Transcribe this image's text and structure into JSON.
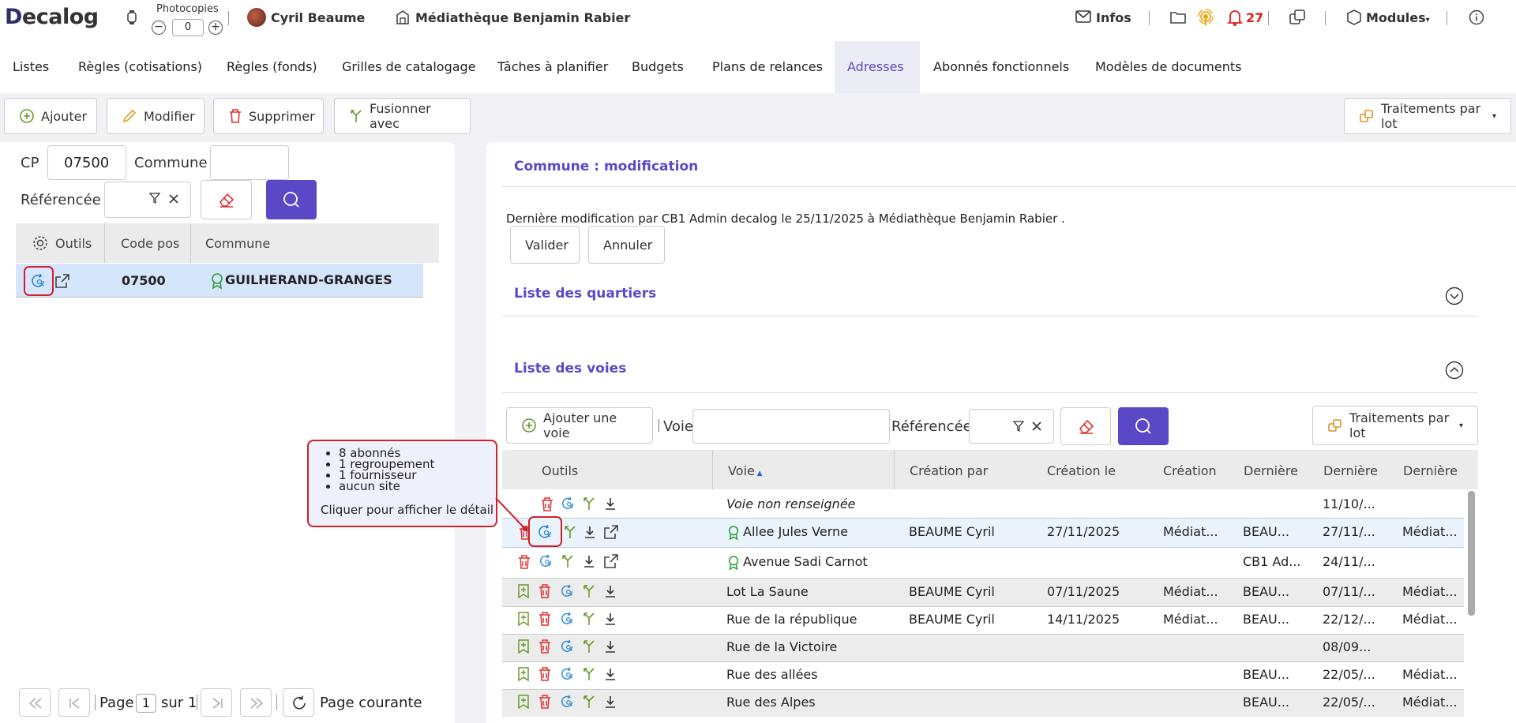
{
  "header": {
    "logo_text": "ecalog",
    "logo_d": "D",
    "photocopies_label": "Photocopies",
    "photocopies_value": "0",
    "user_name": "Cyril Beaume",
    "library_name": "Médiathèque Benjamin Rabier",
    "infos_label": "Infos",
    "notif_count": "27",
    "modules_label": "Modules"
  },
  "tabs": [
    {
      "label": "Listes"
    },
    {
      "label": "Règles (cotisations)"
    },
    {
      "label": "Règles (fonds)"
    },
    {
      "label": "Grilles de catalogage"
    },
    {
      "label": "Tâches à planifier"
    },
    {
      "label": "Budgets"
    },
    {
      "label": "Plans de relances"
    },
    {
      "label": "Adresses"
    },
    {
      "label": "Abonnés fonctionnels"
    },
    {
      "label": "Modèles de documents"
    }
  ],
  "toolbar": {
    "add": "Ajouter",
    "edit": "Modifier",
    "delete": "Supprimer",
    "merge": "Fusionner avec",
    "batch": "Traitements par lot"
  },
  "left": {
    "cp_label": "CP",
    "cp_value": "07500",
    "commune_label": "Commune",
    "commune_value": "",
    "referenced_label": "Référencée",
    "grid_headers": {
      "tools": "Outils",
      "code": "Code post",
      "commune": "Commune"
    },
    "row": {
      "code": "07500",
      "commune": "GUILHERAND-GRANGES"
    },
    "pager": {
      "page_label": "Page",
      "page_value": "1",
      "of_label": "sur 1",
      "current_label": "Page courante"
    }
  },
  "right": {
    "title": "Commune : modification",
    "last_modified": "Dernière modification par CB1 Admin decalog le 25/11/2025 à Médiathèque Benjamin Rabier .",
    "validate": "Valider",
    "cancel": "Annuler",
    "quartiers_title": "Liste des quartiers",
    "voies_title": "Liste des voies",
    "add_voie": "Ajouter une voie",
    "voie_label": "Voie",
    "voie_value": "",
    "referenced_label": "Référencée",
    "batch": "Traitements par lot",
    "grid_headers": {
      "tools": "Outils",
      "voie": "Voie",
      "created_by": "Création par",
      "created_on": "Création le",
      "creation": "Création",
      "last1": "Dernière",
      "last2": "Dernière",
      "last3": "Dernière"
    },
    "rows": [
      {
        "voie": "Voie non renseignée",
        "created_by": "",
        "created_on": "",
        "creation": "",
        "last1": "",
        "last2": "11/10/...",
        "last3": ""
      },
      {
        "voie": "Allee Jules Verne",
        "created_by": "BEAUME Cyril",
        "created_on": "27/11/2025",
        "creation": "Médiat...",
        "last1": "BEAU...",
        "last2": "27/11/...",
        "last3": "Médiat..."
      },
      {
        "voie": "Avenue Sadi Carnot",
        "created_by": "",
        "created_on": "",
        "creation": "",
        "last1": "CB1 Ad...",
        "last2": "24/11/...",
        "last3": ""
      },
      {
        "voie": "Lot La Saune",
        "created_by": "BEAUME Cyril",
        "created_on": "07/11/2025",
        "creation": "Médiat...",
        "last1": "BEAU...",
        "last2": "07/11/...",
        "last3": "Médiat..."
      },
      {
        "voie": "Rue de la république",
        "created_by": "BEAUME Cyril",
        "created_on": "14/11/2025",
        "creation": "Médiat...",
        "last1": "BEAU...",
        "last2": "22/12/...",
        "last3": "Médiat..."
      },
      {
        "voie": "Rue de la Victoire",
        "created_by": "",
        "created_on": "",
        "creation": "",
        "last1": "",
        "last2": "08/09...",
        "last3": ""
      },
      {
        "voie": "Rue des allées",
        "created_by": "",
        "created_on": "",
        "creation": "",
        "last1": "BEAU...",
        "last2": "22/05/...",
        "last3": "Médiat..."
      },
      {
        "voie": "Rue des Alpes",
        "created_by": "",
        "created_on": "",
        "creation": "",
        "last1": "BEAU...",
        "last2": "22/05/...",
        "last3": "Médiat..."
      }
    ]
  },
  "tooltip": {
    "items": [
      "8 abonnés",
      "1 regroupement",
      "1 fournisseur",
      "aucun site"
    ],
    "footer": "Cliquer pour afficher le détail"
  },
  "colors": {
    "accent": "#5a48c7",
    "danger": "#e03030",
    "success": "#2a9d3a",
    "info": "#2a8ad6"
  }
}
